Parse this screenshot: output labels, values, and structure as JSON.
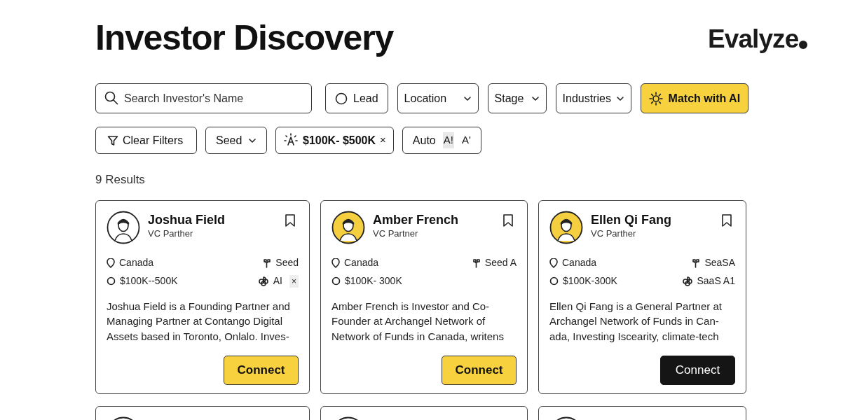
{
  "header": {
    "title": "Investor Discovery",
    "logo": "Evalyze"
  },
  "search": {
    "placeholder": "Search Investor's Name"
  },
  "filters": [
    {
      "kind": "radio",
      "label": "Lead",
      "checked": false
    },
    {
      "kind": "dropdown",
      "label": "Location"
    },
    {
      "kind": "dropdown",
      "label": "Stage"
    },
    {
      "kind": "dropdown",
      "label": "Industries"
    },
    {
      "kind": "ai",
      "label": "Match with AI"
    }
  ],
  "active_filters": [
    {
      "kind": "clear",
      "label": "Clear Filters"
    },
    {
      "kind": "dropdown",
      "label": "Seed"
    },
    {
      "kind": "chip",
      "label": "$100K- $500K",
      "remove": "×"
    },
    {
      "kind": "auto",
      "label": "Auto",
      "options": [
        "A!",
        "A'"
      ]
    }
  ],
  "results_count": "9 Results",
  "cards": [
    {
      "name": "Joshua Field",
      "role": "VC Parther",
      "color": "#ffffff",
      "location": "Canada",
      "range": "$100K--500K",
      "stage": "Seed",
      "industry": "AI",
      "industry_remove": "×",
      "bio": "Joshua Field is a Founding Partner and Managing Partner at Contango Digital Assets based in Toronto, Onlalo. Inves-",
      "connect": {
        "label": "Connect",
        "kind": "accent"
      }
    },
    {
      "name": "Amber French",
      "role": "VC Partner",
      "color": "#f5cf3f",
      "location": "Canada",
      "range": "$100K- 300K",
      "stage": "Seed A",
      "bio": "Amber French is Investor and Co-Founder at Archangel Network of Network of Funds in Canada, writens",
      "connect": {
        "label": "Connect",
        "kind": "accent"
      }
    },
    {
      "name": "Ellen Qi Fang",
      "role": "VC Parther",
      "color": "#f5cf3f",
      "location": "Canada",
      "range": "$100K-300K",
      "stage": "SeaSA",
      "industry": "SaaS A1",
      "bio": "Ellen Qi Fang is a General Partner at Archangel Network of Funds in Can-ada, Investing Iscearity, climate-tech",
      "connect": {
        "label": "Connect",
        "kind": "dark"
      }
    }
  ],
  "more_cards": [
    {
      "kind": "card"
    },
    {
      "kind": "card"
    },
    {
      "kind": "card"
    }
  ]
}
